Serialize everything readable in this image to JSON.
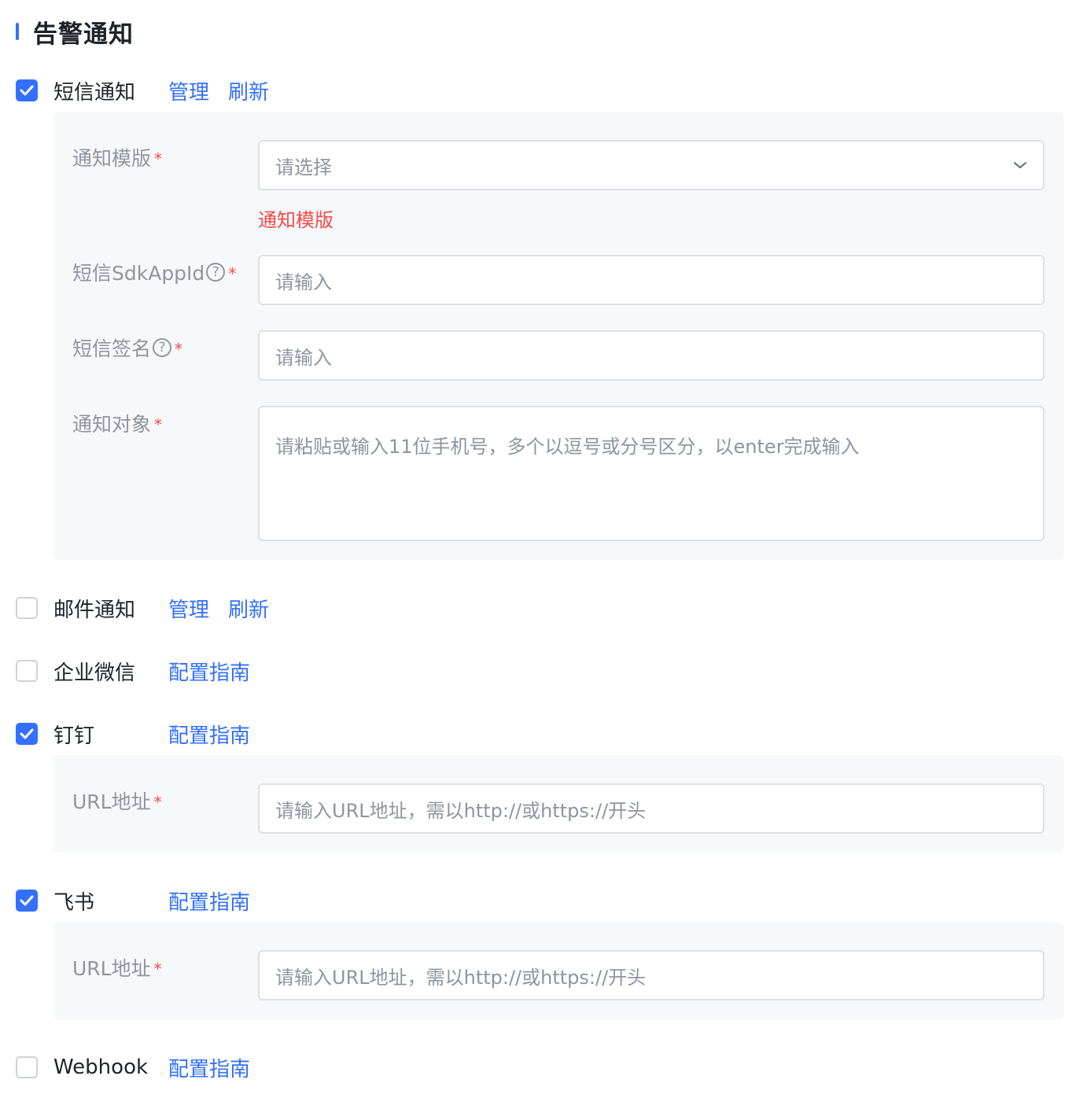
{
  "section": {
    "title": "告警通知"
  },
  "colors": {
    "accent": "#3370ff",
    "required": "#f54a45",
    "panel_bg": "#f7f8fa"
  },
  "sms": {
    "label": "短信通知",
    "checked": true,
    "manage": "管理",
    "refresh": "刷新",
    "template_label": "通知模版",
    "template_placeholder": "请选择",
    "template_error": "通知模版",
    "sdk_label": "短信SdkAppId",
    "sdk_placeholder": "请输入",
    "sign_label": "短信签名",
    "sign_placeholder": "请输入",
    "target_label": "通知对象",
    "target_placeholder": "请粘贴或输入11位手机号，多个以逗号或分号区分，以enter完成输入",
    "help_glyph": "?"
  },
  "email": {
    "label": "邮件通知",
    "checked": false,
    "manage": "管理",
    "refresh": "刷新"
  },
  "wecom": {
    "label": "企业微信",
    "checked": false,
    "guide": "配置指南"
  },
  "dingtalk": {
    "label": "钉钉",
    "checked": true,
    "guide": "配置指南",
    "url_label": "URL地址",
    "url_placeholder": "请输入URL地址，需以http://或https://开头"
  },
  "feishu": {
    "label": "飞书",
    "checked": true,
    "guide": "配置指南",
    "url_label": "URL地址",
    "url_placeholder": "请输入URL地址，需以http://或https://开头"
  },
  "webhook": {
    "label": "Webhook",
    "checked": false,
    "guide": "配置指南"
  },
  "required_mark": "*"
}
